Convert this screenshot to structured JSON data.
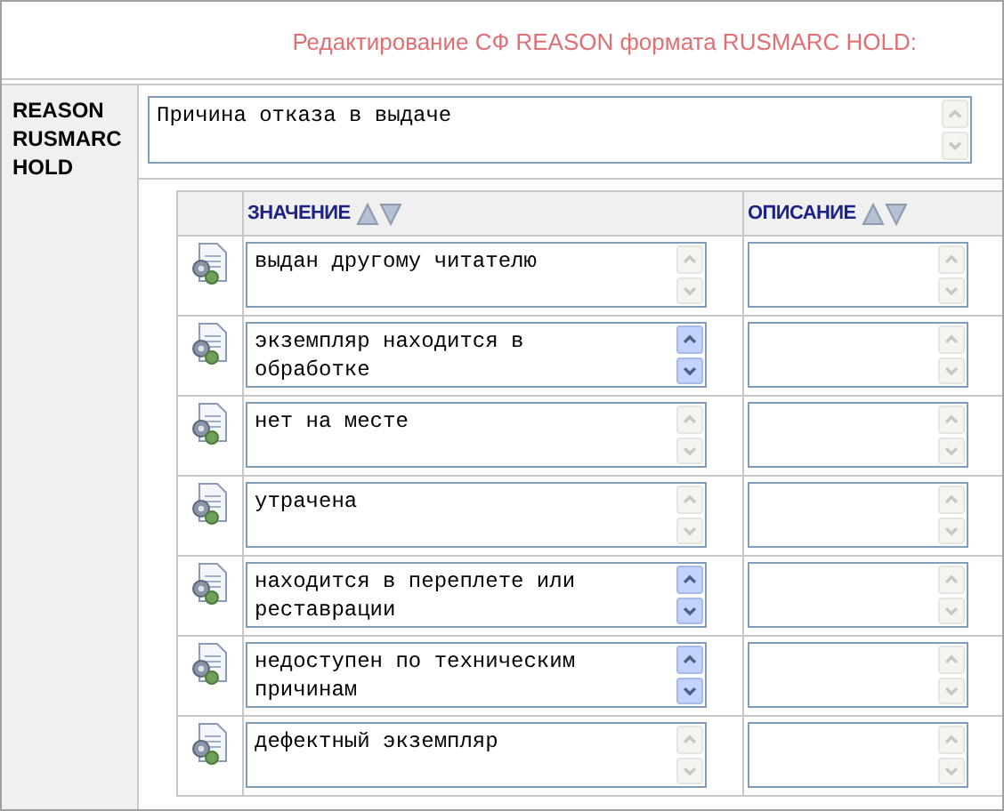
{
  "title": "Редактирование СФ REASON формата RUSMARC HOLD:",
  "field": {
    "label": "REASON RUSMARC HOLD",
    "value": "Причина отказа в выдаче",
    "overflow": false
  },
  "table": {
    "columns": [
      {
        "label": "ЗНАЧЕНИЕ"
      },
      {
        "label": "ОПИСАНИЕ"
      }
    ],
    "rows": [
      {
        "value": "выдан другому читателю",
        "overflow": false
      },
      {
        "value": "экземпляр находится в обработке",
        "overflow": true
      },
      {
        "value": "нет на месте",
        "overflow": false
      },
      {
        "value": "утрачена",
        "overflow": false
      },
      {
        "value": "находится в переплете или реставрации",
        "overflow": true
      },
      {
        "value": "недоступен по техническим причинам",
        "overflow": true
      },
      {
        "value": "дефектный экземпляр",
        "overflow": false
      }
    ]
  }
}
